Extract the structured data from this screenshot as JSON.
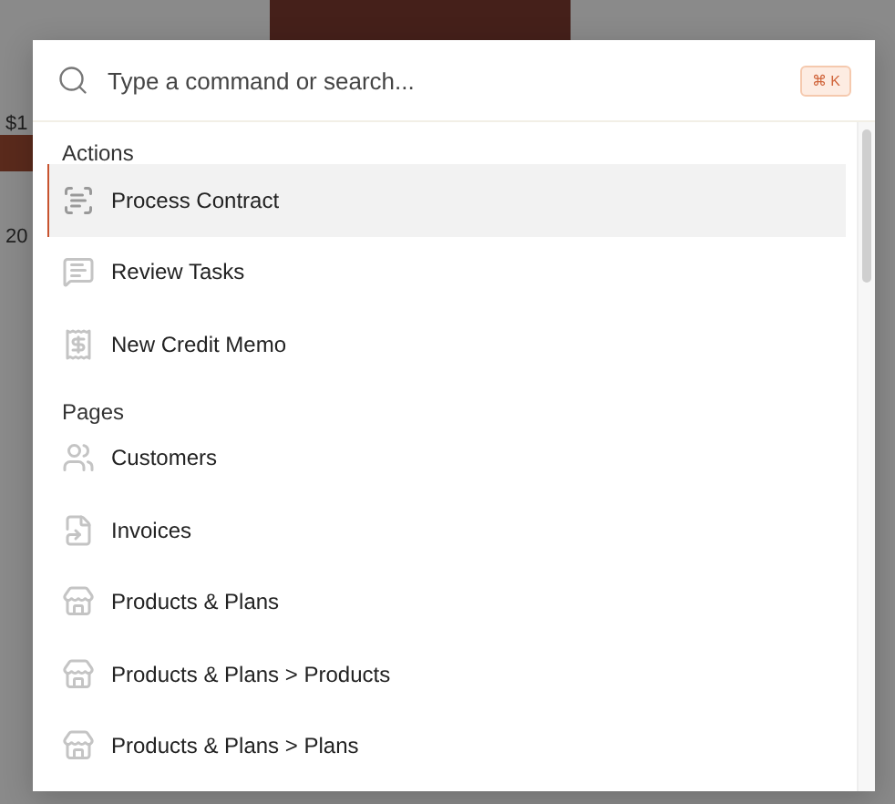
{
  "background": {
    "texts": [
      "$1",
      "20"
    ]
  },
  "command_palette": {
    "search": {
      "placeholder": "Type a command or search..."
    },
    "shortcut": "⌘ K",
    "groups": [
      {
        "title": "Actions",
        "items": [
          {
            "label": "Process Contract",
            "kind": "scan",
            "selected": true
          },
          {
            "label": "Review Tasks",
            "kind": "tasks",
            "selected": false
          },
          {
            "label": "New Credit Memo",
            "kind": "memo",
            "selected": false
          }
        ]
      },
      {
        "title": "Pages",
        "items": [
          {
            "label": "Customers",
            "kind": "people",
            "selected": false
          },
          {
            "label": "Invoices",
            "kind": "invoice",
            "selected": false
          },
          {
            "label": "Products & Plans",
            "kind": "store",
            "selected": false
          },
          {
            "label": "Products & Plans > Products",
            "kind": "store",
            "selected": false
          },
          {
            "label": "Products & Plans > Plans",
            "kind": "store",
            "selected": false
          }
        ]
      }
    ]
  }
}
